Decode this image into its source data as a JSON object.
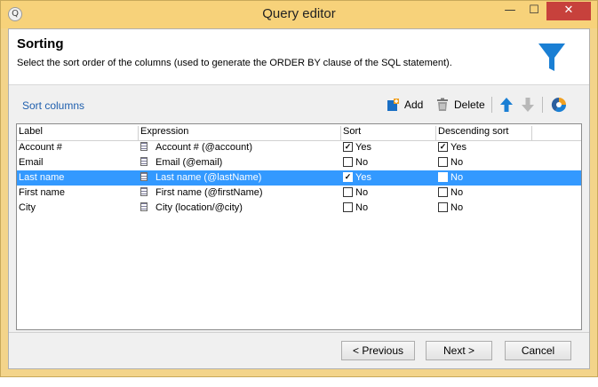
{
  "window": {
    "title": "Query editor",
    "minimize_glyph": "—",
    "maximize_glyph": "☐",
    "close_glyph": "✕",
    "app_icon_glyph": "Q"
  },
  "header": {
    "title": "Sorting",
    "description": "Select the sort order of the columns (used to generate the ORDER BY clause of the SQL statement).",
    "icon": "funnel-icon",
    "accent_color": "#1a7fd4"
  },
  "section": {
    "label": "Sort columns"
  },
  "toolbar": {
    "add_label": "Add",
    "delete_label": "Delete",
    "icons": [
      "add-icon",
      "trash-icon",
      "arrow-up-icon",
      "arrow-down-icon",
      "distribution-icon"
    ]
  },
  "grid": {
    "columns": [
      "Label",
      "Expression",
      "Sort",
      "Descending sort"
    ],
    "rows": [
      {
        "label": "Account #",
        "expression": "Account # (@account)",
        "sort_checked": true,
        "sort_label": "Yes",
        "desc_checked": true,
        "desc_label": "Yes",
        "selected": false
      },
      {
        "label": "Email",
        "expression": "Email (@email)",
        "sort_checked": false,
        "sort_label": "No",
        "desc_checked": false,
        "desc_label": "No",
        "selected": false
      },
      {
        "label": "Last name",
        "expression": "Last name (@lastName)",
        "sort_checked": true,
        "sort_label": "Yes",
        "desc_checked": false,
        "desc_label": "No",
        "selected": true
      },
      {
        "label": "First name",
        "expression": "First name (@firstName)",
        "sort_checked": false,
        "sort_label": "No",
        "desc_checked": false,
        "desc_label": "No",
        "selected": false
      },
      {
        "label": "City",
        "expression": "City (location/@city)",
        "sort_checked": false,
        "sort_label": "No",
        "desc_checked": false,
        "desc_label": "No",
        "selected": false
      }
    ],
    "selection_color": "#3399ff"
  },
  "footer": {
    "previous_label": "< Previous",
    "next_label": "Next >",
    "cancel_label": "Cancel"
  }
}
